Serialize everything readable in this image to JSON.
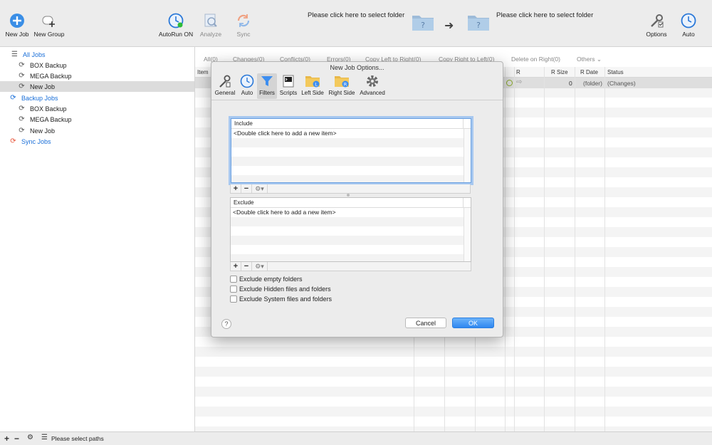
{
  "toolbar": {
    "new_job": "New Job",
    "new_group": "New Group",
    "autorun": "AutoRun ON",
    "analyze": "Analyze",
    "sync": "Sync",
    "left_folder_prompt": "Please click here to select folder",
    "right_folder_prompt": "Please click here to select folder",
    "options": "Options",
    "auto": "Auto"
  },
  "sidebar": {
    "all_jobs": "All Jobs",
    "all_children": [
      "BOX Backup",
      "MEGA Backup",
      "New Job"
    ],
    "backup_jobs": "Backup Jobs",
    "backup_children": [
      "BOX Backup",
      "MEGA Backup",
      "New Job"
    ],
    "sync_jobs": "Sync Jobs"
  },
  "filters": [
    "All(0)",
    "Changes(0)",
    "Conflicts(0)",
    "Errors(0)",
    "Copy Left to Right(0)",
    "Copy Right to Left(0)",
    "Delete on Right(0)",
    "Others"
  ],
  "columns": {
    "item": "Item",
    "r": "R",
    "r_size": "R Size",
    "r_date": "R Date",
    "status": "Status"
  },
  "row": {
    "r_size": "0",
    "r_date": "(folder)",
    "status": "(Changes)"
  },
  "statusbar": {
    "text": "Please select paths"
  },
  "dialog": {
    "title": "New Job Options...",
    "tabs": [
      "General",
      "Auto",
      "Filters",
      "Scripts",
      "Left Side",
      "Right Side",
      "Advanced"
    ],
    "selected_tab": "Filters",
    "include": {
      "header": "Include",
      "placeholder": "<Double click here to add a new item>"
    },
    "exclude": {
      "header": "Exclude",
      "placeholder": "<Double click here to add a new item>"
    },
    "checkboxes": [
      "Exclude empty folders",
      "Exclude Hidden files and folders",
      "Exclude System files and folders"
    ],
    "cancel": "Cancel",
    "ok": "OK",
    "help": "?"
  },
  "colors": {
    "accent": "#1a6fd8",
    "sync_orange": "#e8553a",
    "ok_button": "#2f87f0"
  }
}
